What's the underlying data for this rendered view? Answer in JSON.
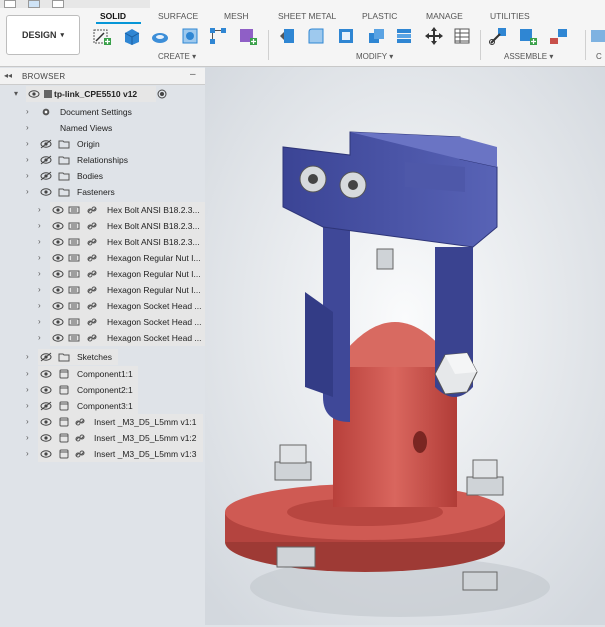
{
  "workspace_button": "DESIGN",
  "tabs": [
    "SOLID",
    "SURFACE",
    "MESH",
    "SHEET METAL",
    "PLASTIC",
    "MANAGE",
    "UTILITIES"
  ],
  "groups": {
    "create": "CREATE",
    "modify": "MODIFY",
    "assemble": "ASSEMBLE",
    "cut_off": "C"
  },
  "browser": {
    "title": "BROWSER",
    "root": "tp-link_CPE5510 v12",
    "items": [
      {
        "label": "Document Settings"
      },
      {
        "label": "Named Views"
      },
      {
        "label": "Origin"
      },
      {
        "label": "Relationships"
      },
      {
        "label": "Bodies"
      },
      {
        "label": "Fasteners"
      },
      {
        "label": "Hex Bolt ANSI B18.2.3..."
      },
      {
        "label": "Hex Bolt ANSI B18.2.3..."
      },
      {
        "label": "Hex Bolt ANSI B18.2.3..."
      },
      {
        "label": "Hexagon Regular Nut I..."
      },
      {
        "label": "Hexagon Regular Nut I..."
      },
      {
        "label": "Hexagon Regular Nut I..."
      },
      {
        "label": "Hexagon Socket Head ..."
      },
      {
        "label": "Hexagon Socket Head ..."
      },
      {
        "label": "Hexagon Socket Head ..."
      },
      {
        "label": "Sketches"
      },
      {
        "label": "Component1:1"
      },
      {
        "label": "Component2:1"
      },
      {
        "label": "Component3:1"
      },
      {
        "label": "Insert _M3_D5_L5mm v1:1"
      },
      {
        "label": "Insert _M3_D5_L5mm v1:2"
      },
      {
        "label": "Insert _M3_D5_L5mm v1:3"
      }
    ]
  },
  "colors": {
    "accent": "#0696d7",
    "part_blue": "#4a55a8",
    "part_red": "#c8504a"
  }
}
